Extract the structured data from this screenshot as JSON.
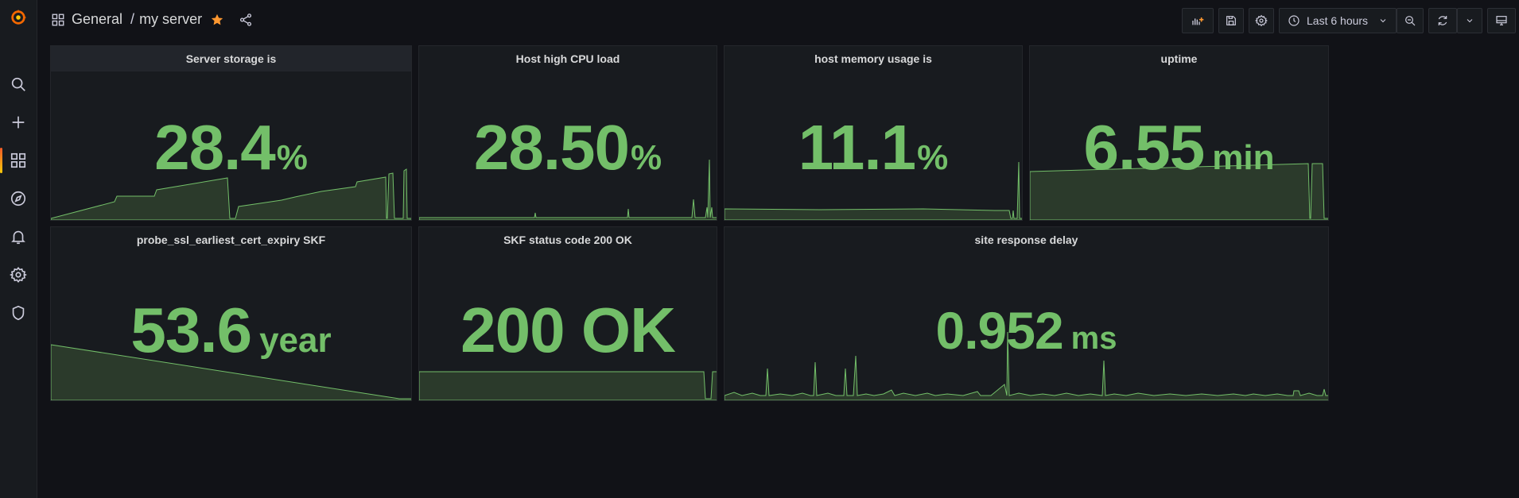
{
  "breadcrumb": {
    "folder": "General",
    "separator": "/",
    "dashboard": "my server"
  },
  "toolbar": {
    "time_range": "Last 6 hours"
  },
  "sidebar": {
    "items": [
      {
        "name": "grafana-logo-icon"
      },
      {
        "name": "search-icon"
      },
      {
        "name": "plus-icon"
      },
      {
        "name": "dashboards-icon"
      },
      {
        "name": "explore-compass-icon"
      },
      {
        "name": "alerting-bell-icon"
      },
      {
        "name": "configuration-gear-icon"
      },
      {
        "name": "shield-icon"
      }
    ]
  },
  "colors": {
    "stat_green": "#73bf69",
    "accent_orange": "#ff9830",
    "fill": "#2b3a2b"
  },
  "panels": [
    {
      "title": "Server storage is",
      "value": "28.4",
      "unit": "%"
    },
    {
      "title": "Host high CPU load",
      "value": "28.50",
      "unit": "%"
    },
    {
      "title": "host memory usage is",
      "value": "11.1",
      "unit": "%"
    },
    {
      "title": "uptime",
      "value": "6.55",
      "unit": "min"
    },
    {
      "title": "probe_ssl_earliest_cert_expiry SKF",
      "value": "53.6",
      "unit": "year"
    },
    {
      "title": "SKF status code 200 OK",
      "value": "200 OK",
      "unit": ""
    },
    {
      "title": "site response delay",
      "value": "0.952",
      "unit": "ms"
    }
  ]
}
